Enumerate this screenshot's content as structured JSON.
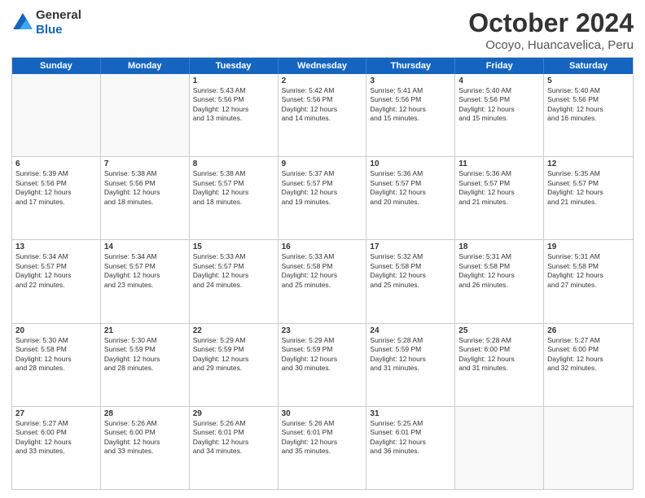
{
  "logo": {
    "line1": "General",
    "line2": "Blue"
  },
  "title": "October 2024",
  "subtitle": "Ocoyo, Huancavelica, Peru",
  "header_days": [
    "Sunday",
    "Monday",
    "Tuesday",
    "Wednesday",
    "Thursday",
    "Friday",
    "Saturday"
  ],
  "weeks": [
    [
      {
        "day": "",
        "lines": []
      },
      {
        "day": "",
        "lines": []
      },
      {
        "day": "1",
        "lines": [
          "Sunrise: 5:43 AM",
          "Sunset: 5:56 PM",
          "Daylight: 12 hours",
          "and 13 minutes."
        ]
      },
      {
        "day": "2",
        "lines": [
          "Sunrise: 5:42 AM",
          "Sunset: 5:56 PM",
          "Daylight: 12 hours",
          "and 14 minutes."
        ]
      },
      {
        "day": "3",
        "lines": [
          "Sunrise: 5:41 AM",
          "Sunset: 5:56 PM",
          "Daylight: 12 hours",
          "and 15 minutes."
        ]
      },
      {
        "day": "4",
        "lines": [
          "Sunrise: 5:40 AM",
          "Sunset: 5:56 PM",
          "Daylight: 12 hours",
          "and 15 minutes."
        ]
      },
      {
        "day": "5",
        "lines": [
          "Sunrise: 5:40 AM",
          "Sunset: 5:56 PM",
          "Daylight: 12 hours",
          "and 16 minutes."
        ]
      }
    ],
    [
      {
        "day": "6",
        "lines": [
          "Sunrise: 5:39 AM",
          "Sunset: 5:56 PM",
          "Daylight: 12 hours",
          "and 17 minutes."
        ]
      },
      {
        "day": "7",
        "lines": [
          "Sunrise: 5:38 AM",
          "Sunset: 5:56 PM",
          "Daylight: 12 hours",
          "and 18 minutes."
        ]
      },
      {
        "day": "8",
        "lines": [
          "Sunrise: 5:38 AM",
          "Sunset: 5:57 PM",
          "Daylight: 12 hours",
          "and 18 minutes."
        ]
      },
      {
        "day": "9",
        "lines": [
          "Sunrise: 5:37 AM",
          "Sunset: 5:57 PM",
          "Daylight: 12 hours",
          "and 19 minutes."
        ]
      },
      {
        "day": "10",
        "lines": [
          "Sunrise: 5:36 AM",
          "Sunset: 5:57 PM",
          "Daylight: 12 hours",
          "and 20 minutes."
        ]
      },
      {
        "day": "11",
        "lines": [
          "Sunrise: 5:36 AM",
          "Sunset: 5:57 PM",
          "Daylight: 12 hours",
          "and 21 minutes."
        ]
      },
      {
        "day": "12",
        "lines": [
          "Sunrise: 5:35 AM",
          "Sunset: 5:57 PM",
          "Daylight: 12 hours",
          "and 21 minutes."
        ]
      }
    ],
    [
      {
        "day": "13",
        "lines": [
          "Sunrise: 5:34 AM",
          "Sunset: 5:57 PM",
          "Daylight: 12 hours",
          "and 22 minutes."
        ]
      },
      {
        "day": "14",
        "lines": [
          "Sunrise: 5:34 AM",
          "Sunset: 5:57 PM",
          "Daylight: 12 hours",
          "and 23 minutes."
        ]
      },
      {
        "day": "15",
        "lines": [
          "Sunrise: 5:33 AM",
          "Sunset: 5:57 PM",
          "Daylight: 12 hours",
          "and 24 minutes."
        ]
      },
      {
        "day": "16",
        "lines": [
          "Sunrise: 5:33 AM",
          "Sunset: 5:58 PM",
          "Daylight: 12 hours",
          "and 25 minutes."
        ]
      },
      {
        "day": "17",
        "lines": [
          "Sunrise: 5:32 AM",
          "Sunset: 5:58 PM",
          "Daylight: 12 hours",
          "and 25 minutes."
        ]
      },
      {
        "day": "18",
        "lines": [
          "Sunrise: 5:31 AM",
          "Sunset: 5:58 PM",
          "Daylight: 12 hours",
          "and 26 minutes."
        ]
      },
      {
        "day": "19",
        "lines": [
          "Sunrise: 5:31 AM",
          "Sunset: 5:58 PM",
          "Daylight: 12 hours",
          "and 27 minutes."
        ]
      }
    ],
    [
      {
        "day": "20",
        "lines": [
          "Sunrise: 5:30 AM",
          "Sunset: 5:58 PM",
          "Daylight: 12 hours",
          "and 28 minutes."
        ]
      },
      {
        "day": "21",
        "lines": [
          "Sunrise: 5:30 AM",
          "Sunset: 5:59 PM",
          "Daylight: 12 hours",
          "and 28 minutes."
        ]
      },
      {
        "day": "22",
        "lines": [
          "Sunrise: 5:29 AM",
          "Sunset: 5:59 PM",
          "Daylight: 12 hours",
          "and 29 minutes."
        ]
      },
      {
        "day": "23",
        "lines": [
          "Sunrise: 5:29 AM",
          "Sunset: 5:59 PM",
          "Daylight: 12 hours",
          "and 30 minutes."
        ]
      },
      {
        "day": "24",
        "lines": [
          "Sunrise: 5:28 AM",
          "Sunset: 5:59 PM",
          "Daylight: 12 hours",
          "and 31 minutes."
        ]
      },
      {
        "day": "25",
        "lines": [
          "Sunrise: 5:28 AM",
          "Sunset: 6:00 PM",
          "Daylight: 12 hours",
          "and 31 minutes."
        ]
      },
      {
        "day": "26",
        "lines": [
          "Sunrise: 5:27 AM",
          "Sunset: 6:00 PM",
          "Daylight: 12 hours",
          "and 32 minutes."
        ]
      }
    ],
    [
      {
        "day": "27",
        "lines": [
          "Sunrise: 5:27 AM",
          "Sunset: 6:00 PM",
          "Daylight: 12 hours",
          "and 33 minutes."
        ]
      },
      {
        "day": "28",
        "lines": [
          "Sunrise: 5:26 AM",
          "Sunset: 6:00 PM",
          "Daylight: 12 hours",
          "and 33 minutes."
        ]
      },
      {
        "day": "29",
        "lines": [
          "Sunrise: 5:26 AM",
          "Sunset: 6:01 PM",
          "Daylight: 12 hours",
          "and 34 minutes."
        ]
      },
      {
        "day": "30",
        "lines": [
          "Sunrise: 5:26 AM",
          "Sunset: 6:01 PM",
          "Daylight: 12 hours",
          "and 35 minutes."
        ]
      },
      {
        "day": "31",
        "lines": [
          "Sunrise: 5:25 AM",
          "Sunset: 6:01 PM",
          "Daylight: 12 hours",
          "and 36 minutes."
        ]
      },
      {
        "day": "",
        "lines": []
      },
      {
        "day": "",
        "lines": []
      }
    ]
  ]
}
